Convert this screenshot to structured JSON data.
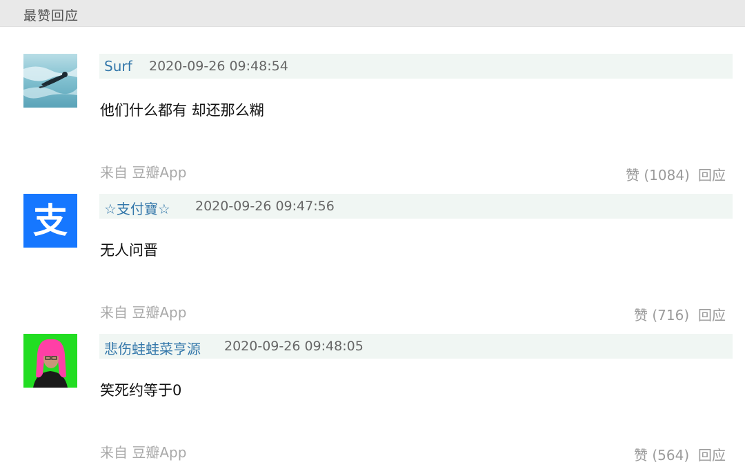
{
  "section": {
    "title": "最赞回应"
  },
  "comments": [
    {
      "author": "Surf",
      "time": "2020-09-26 09:48:54",
      "content": "他们什么都有 却还那么糊",
      "source": "来自 豆瓣App",
      "vote": "赞 (1084)",
      "reply": "回应",
      "avatar": "surfer-photo"
    },
    {
      "author": "☆支付寶☆",
      "time": "2020-09-26 09:47:56",
      "content": "无人问晋",
      "source": "来自 豆瓣App",
      "vote": "赞 (716)",
      "reply": "回应",
      "avatar": "alipay-logo",
      "avatar_glyph": "支"
    },
    {
      "author": "悲伤蛙蛙菜亨源",
      "time": "2020-09-26 09:48:05",
      "content": "笑死约等于0",
      "source": "来自 豆瓣App",
      "vote": "赞 (564)",
      "reply": "回应",
      "avatar": "pink-hair-person-photo"
    }
  ],
  "colors": {
    "author_link": "#3377aa",
    "meta_bar_bg": "#f0f6f3",
    "header_bg": "#e9e9e9",
    "alipay_blue": "#1677ff",
    "avatar3_bg": "#22dd22"
  }
}
